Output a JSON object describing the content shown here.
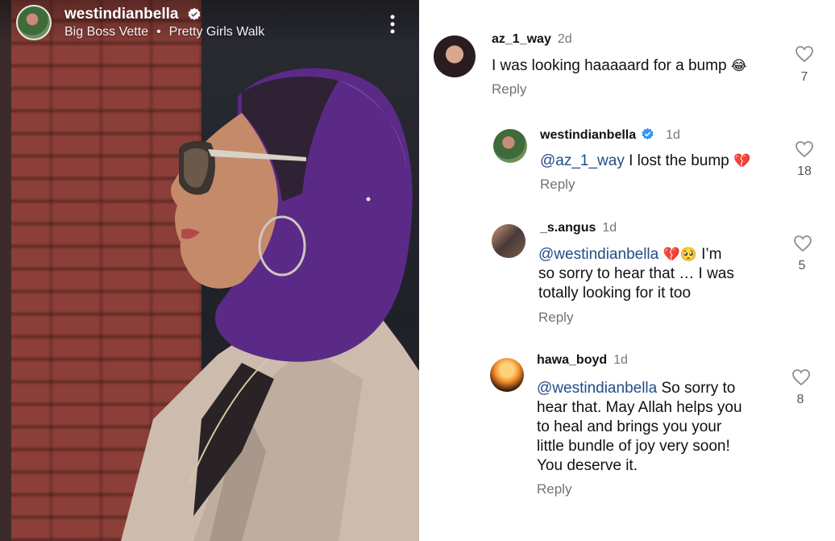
{
  "post": {
    "username": "westindianbella",
    "song_title": "Big Boss Vette",
    "separator": "•",
    "song_name": "Pretty Girls Walk"
  },
  "comments": [
    {
      "username": "az_1_way",
      "time": "2d",
      "text": "I was looking haaaaard for a bump",
      "emoji": "😂",
      "reply_label": "Reply",
      "likes": "7"
    },
    {
      "username": "westindianbella",
      "time": "1d",
      "mention": "@az_1_way",
      "text": " I lost the bump ",
      "emoji": "💔",
      "reply_label": "Reply",
      "likes": "18"
    },
    {
      "username": "_s.angus",
      "time": "1d",
      "mention": "@westindianbella",
      "emoji": "💔🥺",
      "line1_rest": " I’m",
      "line2": "so sorry to hear that … I was",
      "line3": "totally looking for it too",
      "reply_label": "Reply",
      "likes": "5"
    },
    {
      "username": "hawa_boyd",
      "time": "1d",
      "mention": "@westindianbella",
      "line1_rest": " So sorry to",
      "line2": "hear that. May Allah helps you",
      "line3": "to heal and brings you your",
      "line4": "little bundle of joy very soon!",
      "line5": "You deserve it.",
      "reply_label": "Reply",
      "likes": "8"
    }
  ],
  "colors": {
    "mention": "#1f4d8a",
    "verified": "#3897f0",
    "hijab": "#5b2a86"
  }
}
